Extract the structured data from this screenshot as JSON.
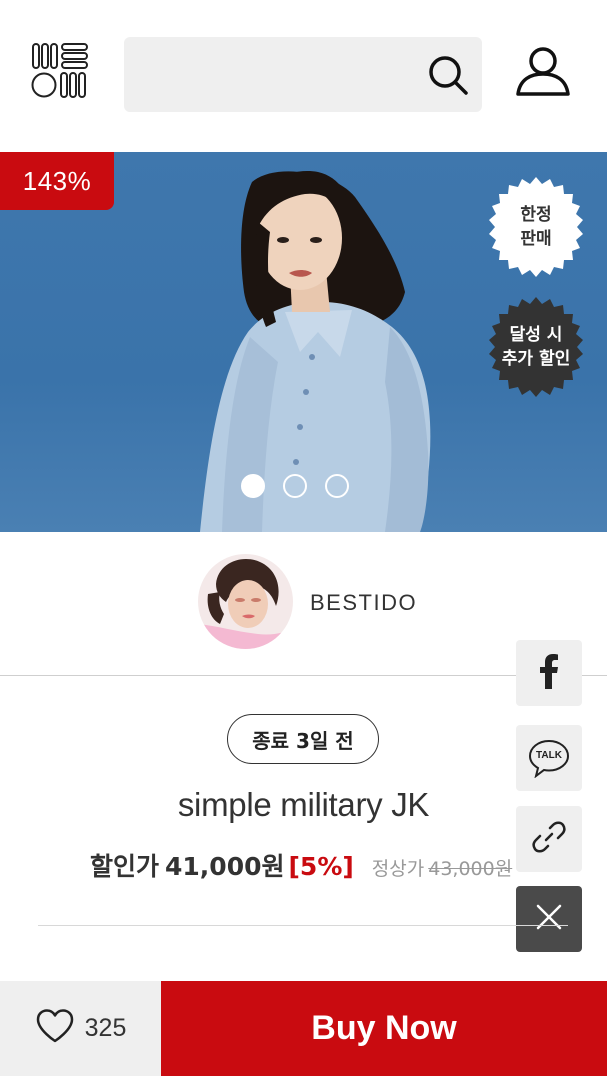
{
  "header": {
    "search_placeholder": "",
    "logo_icon": "brand-logo-icon",
    "search_icon": "search-icon",
    "user_icon": "user-icon"
  },
  "hero": {
    "discount_badge": "143%",
    "stamp_limited": "한정\n판매",
    "stamp_bonus": "달성 시\n추가 할인",
    "slide_count": 3,
    "active_slide": 1,
    "background_color": "#3a73aa"
  },
  "seller": {
    "name": "BESTIDO"
  },
  "share": {
    "items": [
      "facebook-icon",
      "kakaotalk-icon",
      "link-icon",
      "close-icon"
    ],
    "talk_label": "TALK"
  },
  "product": {
    "deadline": "종료 3일 전",
    "title": "simple military JK",
    "sale_label": "할인가",
    "sale_price": "41,000원",
    "discount": "[5%]",
    "regular_label": "정상가",
    "regular_price": "43,000원"
  },
  "footer": {
    "like_count": "325",
    "buy_label": "Buy Now"
  },
  "colors": {
    "accent": "#c90b10",
    "light_gray": "#efefef",
    "dark_gray": "#4a4a4a"
  }
}
